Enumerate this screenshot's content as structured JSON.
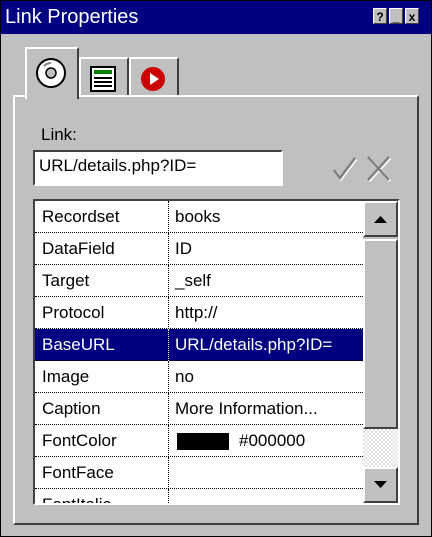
{
  "window": {
    "title": "Link Properties",
    "title_buttons": [
      "?",
      "_",
      "x"
    ]
  },
  "tabs": [
    {
      "icon": "disc-icon"
    },
    {
      "icon": "document-lines-icon"
    },
    {
      "icon": "record-play-icon"
    }
  ],
  "link": {
    "label": "Link:",
    "value": "URL/details.php?ID="
  },
  "colors": {
    "title_bg": "#000080",
    "face": "#c0c0c0",
    "selection": "#000080",
    "font_swatch": "#000000"
  },
  "properties": [
    {
      "name": "Recordset",
      "value": "books"
    },
    {
      "name": "DataField",
      "value": "ID"
    },
    {
      "name": "Target",
      "value": "_self"
    },
    {
      "name": "Protocol",
      "value": "http://"
    },
    {
      "name": "BaseURL",
      "value": "URL/details.php?ID=",
      "selected": true
    },
    {
      "name": "Image",
      "value": "no"
    },
    {
      "name": "Caption",
      "value": "More Information..."
    },
    {
      "name": "FontColor",
      "value": "#000000"
    },
    {
      "name": "FontFace",
      "value": ""
    },
    {
      "name": "FontItalic",
      "value": ""
    }
  ]
}
